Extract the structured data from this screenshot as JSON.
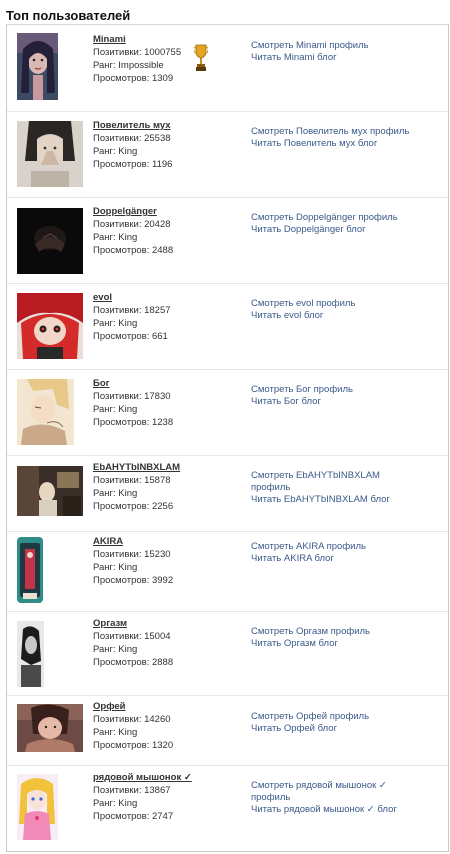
{
  "page_title": "Топ пользователей",
  "users": [
    {
      "name": "Minami",
      "positives": "Позитивки: 1000755",
      "rank": "Ранг: Impossible",
      "views": "Просмотров: 1309",
      "profile_link": "Смотреть Minami профиль",
      "blog_link": "Читать Minami блог",
      "trophy": "trophy-icon"
    },
    {
      "name": "Повелитель мух",
      "positives": "Позитивки: 25538",
      "rank": "Ранг: King",
      "views": "Просмотров: 1196",
      "profile_link": "Смотреть Повелитель мух профиль",
      "blog_link": "Читать Повелитель мух блог"
    },
    {
      "name": "Doppelgänger",
      "positives": "Позитивки: 20428",
      "rank": "Ранг: King",
      "views": "Просмотров: 2488",
      "profile_link": "Смотреть Doppelgänger профиль",
      "blog_link": "Читать Doppelgänger блог"
    },
    {
      "name": "evol",
      "positives": "Позитивки: 18257",
      "rank": "Ранг: King",
      "views": "Просмотров: 661",
      "profile_link": "Смотреть evol профиль",
      "blog_link": "Читать evol блог"
    },
    {
      "name": "Бог",
      "positives": "Позитивки: 17830",
      "rank": "Ранг: King",
      "views": "Просмотров: 1238",
      "profile_link": "Смотреть Бог профиль",
      "blog_link": "Читать Бог блог"
    },
    {
      "name": "EbAHYTbINBXLAM",
      "positives": "Позитивки: 15878",
      "rank": "Ранг: King",
      "views": "Просмотров: 2256",
      "profile_link": "Смотреть EbAHYTbINBXLAM профиль",
      "blog_link": "Читать EbAHYTbINBXLAM блог"
    },
    {
      "name": "AKIRA",
      "positives": "Позитивки: 15230",
      "rank": "Ранг: King",
      "views": "Просмотров: 3992",
      "profile_link": "Смотреть AKIRA профиль",
      "blog_link": "Читать AKIRA блог"
    },
    {
      "name": "Оргазм",
      "positives": "Позитивки: 15004",
      "rank": "Ранг: King",
      "views": "Просмотров: 2888",
      "profile_link": "Смотреть Оргазм профиль",
      "blog_link": "Читать Оргазм блог"
    },
    {
      "name": "Орфей",
      "positives": "Позитивки: 14260",
      "rank": "Ранг: King",
      "views": "Просмотров: 1320",
      "profile_link": "Смотреть Орфей профиль",
      "blog_link": "Читать Орфей блог"
    },
    {
      "name": "рядовой мышонок ✓",
      "positives": "Позитивки: 13867",
      "rank": "Ранг: King",
      "views": "Просмотров: 2747",
      "profile_link": "Смотреть рядовой мышонок ✓ профиль",
      "blog_link": "Читать рядовой мышонок ✓ блог"
    }
  ]
}
